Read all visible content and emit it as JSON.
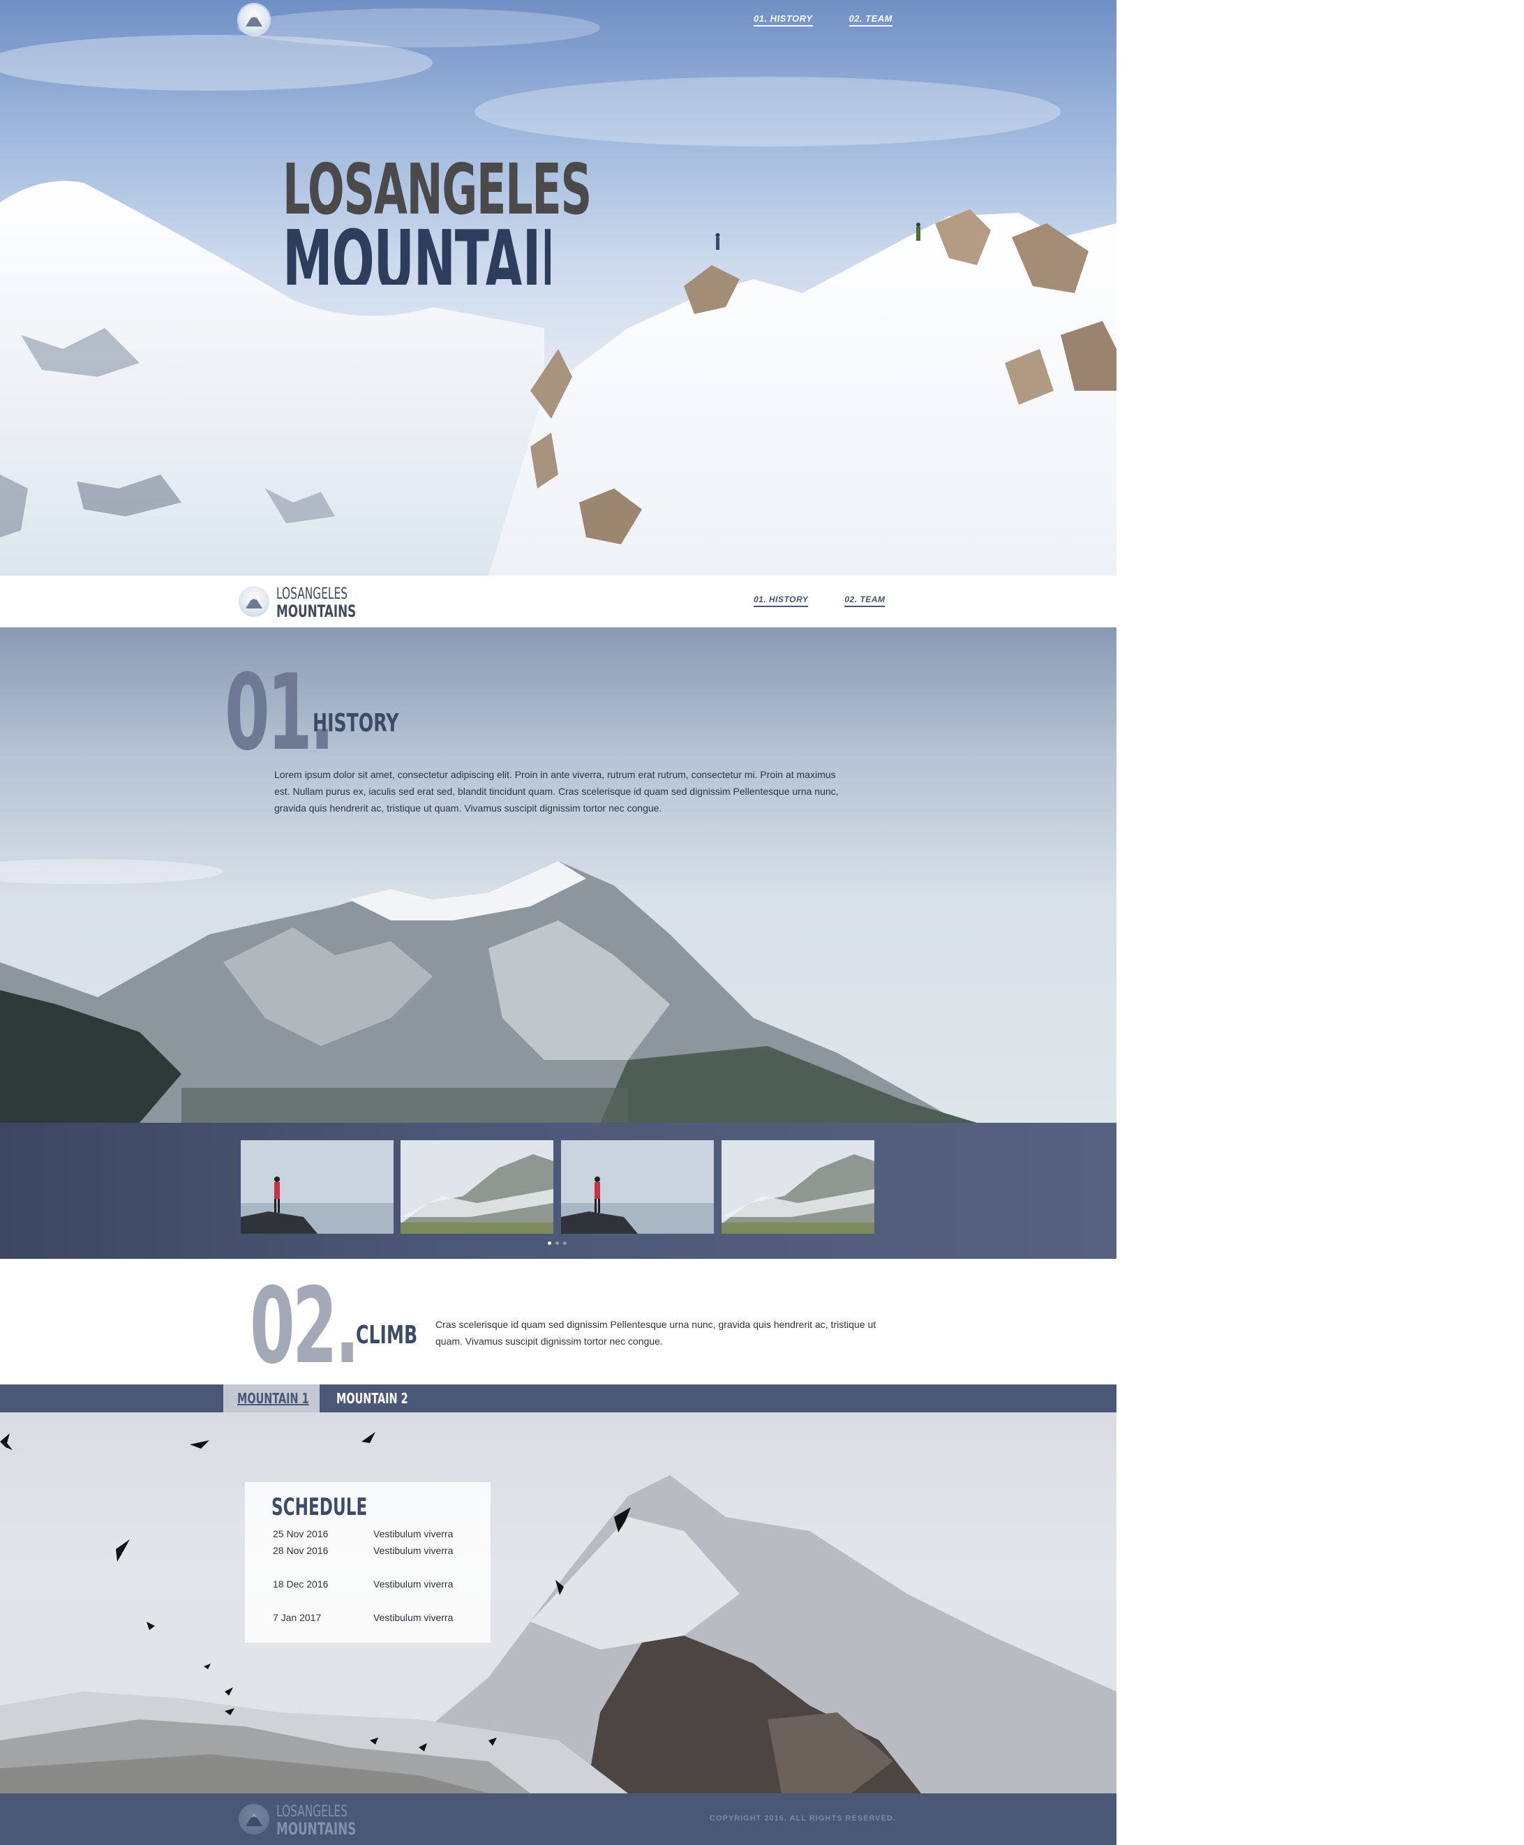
{
  "brand": {
    "line1": "LOSANGELES",
    "line2": "MOUNTAINS"
  },
  "nav": {
    "history": "01. HISTORY",
    "team": "02. TEAM"
  },
  "hero": {
    "title_line1": "LOSANGELES",
    "title_line2": "MOUNTAINS"
  },
  "history": {
    "number": "01.",
    "title": "HISTORY",
    "text": "Lorem ipsum dolor sit amet, consectetur adipiscing elit. Proin in ante viverra, rutrum erat rutrum, consectetur mi. Proin at maximus est. Nullam purus ex, iaculis sed erat sed, blandit tincidunt quam. Cras scelerisque id quam sed dignissim Pellentesque urna nunc, gravida quis hendrerit ac, tristique ut quam. Vivamus suscipit dignissim tortor nec congue."
  },
  "gallery": {
    "thumbnails": [
      "hiker-on-rock",
      "misty-valley",
      "hiker-on-rock",
      "misty-valley"
    ],
    "dots": 3,
    "active_dot": 0
  },
  "climb": {
    "number": "02.",
    "title": "CLIMB",
    "text": "Cras scelerisque id quam sed dignissim Pellentesque urna nunc, gravida quis hendrerit ac, tristique ut quam. Vivamus suscipit dignissim tortor nec congue."
  },
  "tabs": [
    {
      "label": "MOUNTAIN 1",
      "active": true
    },
    {
      "label": "MOUNTAIN 2",
      "active": false
    }
  ],
  "schedule": {
    "title": "SCHEDULE",
    "rows": [
      {
        "date": "25 Nov 2016",
        "text": "Vestibulum viverra"
      },
      {
        "date": "28 Nov 2016",
        "text": "Vestibulum viverra"
      },
      {
        "date": "18 Dec 2016",
        "text": "Vestibulum viverra"
      },
      {
        "date": "7 Jan 2017",
        "text": "Vestibulum viverra"
      }
    ]
  },
  "footer": {
    "copyright": "COPYRIGHT 2016. ALL RIGHTS RESERVED."
  },
  "colors": {
    "navy": "#4a5776",
    "title": "#3e4b68",
    "hero_title_dark": "#2f3d5c",
    "hero_title_grey": "#4a4a4a"
  }
}
